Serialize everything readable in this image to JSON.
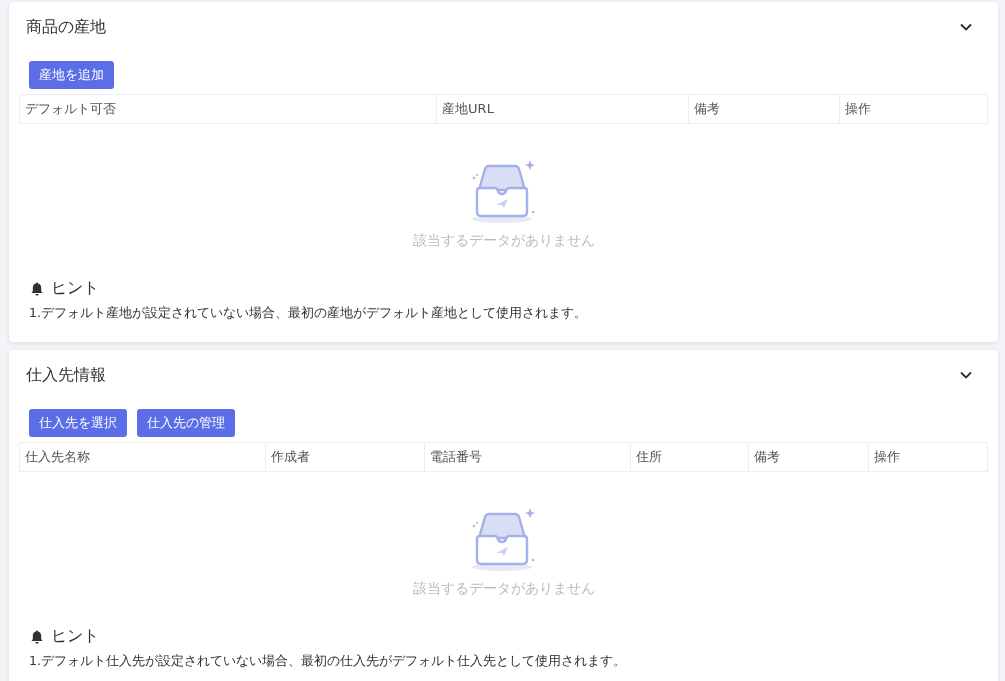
{
  "sections": [
    {
      "title": "商品の産地",
      "expanded": true,
      "buttons": [
        "産地を追加"
      ],
      "columns": [
        "デフォルト可否",
        "産地URL",
        "備考",
        "操作"
      ],
      "empty_text": "該当するデータがありません",
      "hint_title": "ヒント",
      "hint_text": "1.デフォルト産地が設定されていない場合、最初の産地がデフォルト産地として使用されます。"
    },
    {
      "title": "仕入先情報",
      "expanded": true,
      "buttons": [
        "仕入先を選択",
        "仕入先の管理"
      ],
      "columns": [
        "仕入先名称",
        "作成者",
        "電話番号",
        "住所",
        "備考",
        "操作"
      ],
      "empty_text": "該当するデータがありません",
      "hint_title": "ヒント",
      "hint_text": "1.デフォルト仕入先が設定されていない場合、最初の仕入先がデフォルト仕入先として使用されます。"
    }
  ]
}
